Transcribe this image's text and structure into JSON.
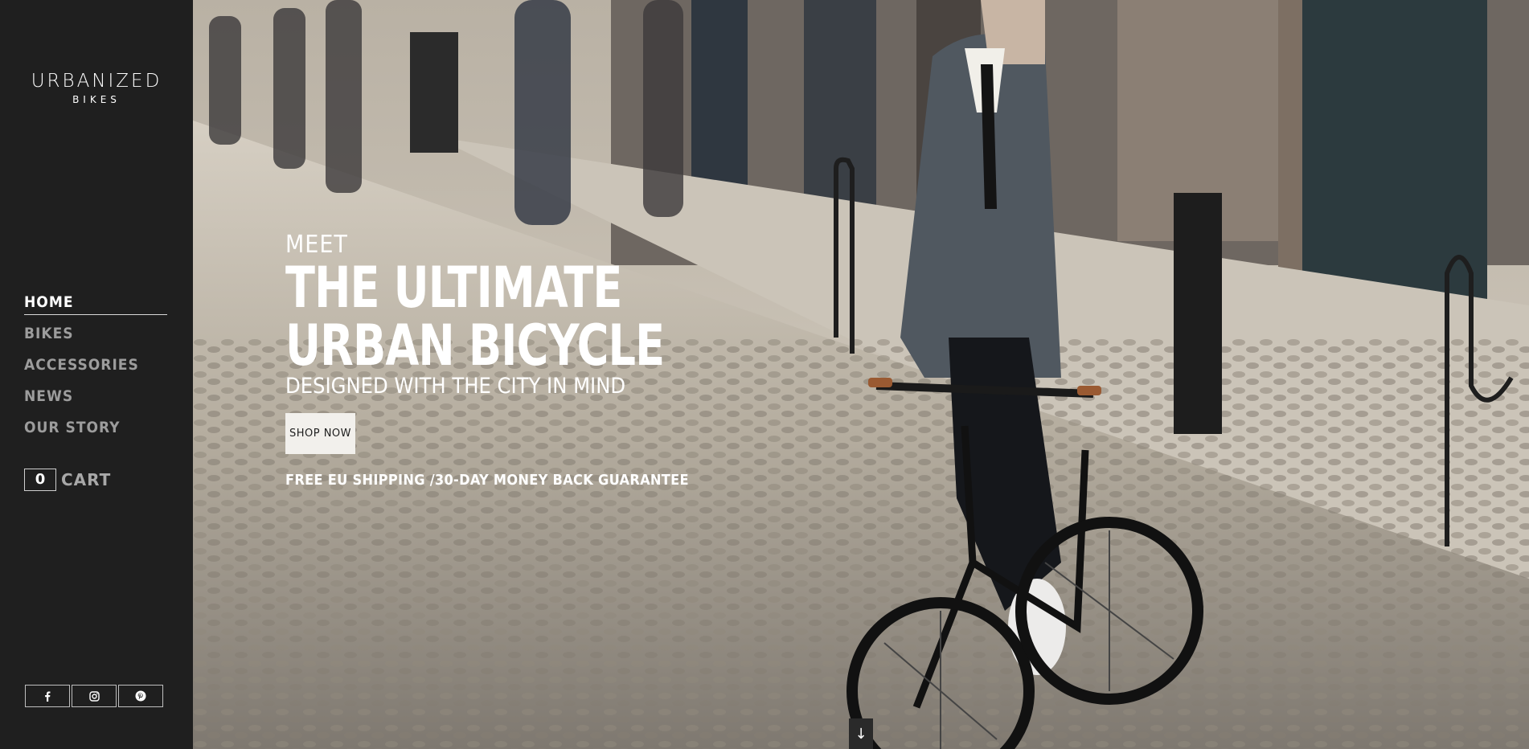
{
  "brand": {
    "name": "URBANIZED",
    "sub": "BIKES"
  },
  "nav": {
    "items": [
      {
        "label": "HOME",
        "active": true
      },
      {
        "label": "BIKES",
        "active": false
      },
      {
        "label": "ACCESSORIES",
        "active": false
      },
      {
        "label": "NEWS",
        "active": false
      },
      {
        "label": "OUR STORY",
        "active": false
      }
    ]
  },
  "cart": {
    "count": "0",
    "label": "CART"
  },
  "social": {
    "icons": [
      "facebook-icon",
      "instagram-icon",
      "pinterest-icon"
    ]
  },
  "hero": {
    "kicker": "MEET",
    "headline_line1": "THE ULTIMATE",
    "headline_line2": "URBAN BICYCLE",
    "tagline": "DESIGNED WITH THE CITY IN MIND",
    "cta_label": "SHOP NOW",
    "shipping": "FREE EU SHIPPING /30-DAY MONEY BACK GUARANTEE",
    "scroll_glyph": "↓"
  },
  "colors": {
    "sidebar": "#1f1f1f",
    "text": "#ffffff",
    "nav_inactive": "#9c9c9c"
  }
}
